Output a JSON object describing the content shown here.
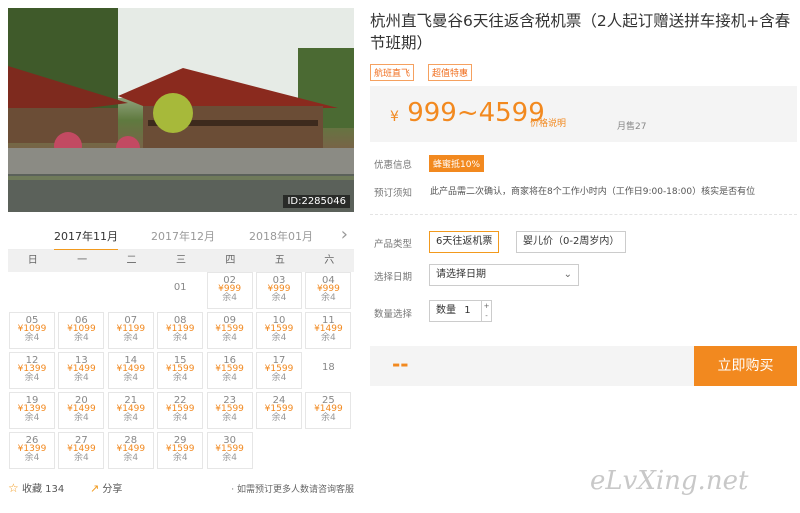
{
  "photo": {
    "id_label": "ID:2285046"
  },
  "calendar": {
    "months": [
      "2017年11月",
      "2017年12月",
      "2018年01月"
    ],
    "weekdays": [
      "日",
      "一",
      "二",
      "三",
      "四",
      "五",
      "六"
    ],
    "days": [
      {
        "d": "01"
      },
      {
        "d": "02",
        "p": "¥999",
        "r": "余4"
      },
      {
        "d": "03",
        "p": "¥999",
        "r": "余4"
      },
      {
        "d": "04",
        "p": "¥999",
        "r": "余4"
      },
      {
        "d": "05",
        "p": "¥1099",
        "r": "余4"
      },
      {
        "d": "06",
        "p": "¥1099",
        "r": "余4"
      },
      {
        "d": "07",
        "p": "¥1199",
        "r": "余4"
      },
      {
        "d": "08",
        "p": "¥1199",
        "r": "余4"
      },
      {
        "d": "09",
        "p": "¥1599",
        "r": "余4"
      },
      {
        "d": "10",
        "p": "¥1599",
        "r": "余4"
      },
      {
        "d": "11",
        "p": "¥1499",
        "r": "余4"
      },
      {
        "d": "12",
        "p": "¥1399",
        "r": "余4"
      },
      {
        "d": "13",
        "p": "¥1499",
        "r": "余4"
      },
      {
        "d": "14",
        "p": "¥1499",
        "r": "余4"
      },
      {
        "d": "15",
        "p": "¥1599",
        "r": "余4"
      },
      {
        "d": "16",
        "p": "¥1599",
        "r": "余4"
      },
      {
        "d": "17",
        "p": "¥1599",
        "r": "余4"
      },
      {
        "d": "18"
      },
      {
        "d": "19",
        "p": "¥1399",
        "r": "余4"
      },
      {
        "d": "20",
        "p": "¥1499",
        "r": "余4"
      },
      {
        "d": "21",
        "p": "¥1499",
        "r": "余4"
      },
      {
        "d": "22",
        "p": "¥1599",
        "r": "余4"
      },
      {
        "d": "23",
        "p": "¥1599",
        "r": "余4"
      },
      {
        "d": "24",
        "p": "¥1599",
        "r": "余4"
      },
      {
        "d": "25",
        "p": "¥1499",
        "r": "余4"
      },
      {
        "d": "26",
        "p": "¥1399",
        "r": "余4"
      },
      {
        "d": "27",
        "p": "¥1499",
        "r": "余4"
      },
      {
        "d": "28",
        "p": "¥1499",
        "r": "余4"
      },
      {
        "d": "29",
        "p": "¥1599",
        "r": "余4"
      },
      {
        "d": "30",
        "p": "¥1599",
        "r": "余4"
      }
    ]
  },
  "share": {
    "fav_label": "收藏",
    "fav_count": "134",
    "share_label": "分享",
    "note": "· 如需预订更多人数请咨询客服"
  },
  "product": {
    "title": "杭州直飞曼谷6天往返含税机票（2人起订赠送拼车接机+含春节班期）",
    "tags": [
      "航班直飞",
      "超值特惠"
    ],
    "price_symbol": "¥",
    "price": "999~4599",
    "price_note": "价格说明",
    "sold": "月售27"
  },
  "info": {
    "promo_label": "优惠信息",
    "promo_badge": "蜂蜜抵10%",
    "notice_label": "预订须知",
    "notice_text": "此产品需二次确认，商家将在8个工作小时内（工作日9:00-18:00）核实是否有位"
  },
  "booking": {
    "type_label": "产品类型",
    "options": [
      "6天往返机票",
      "婴儿价（0-2周岁内）"
    ],
    "date_label": "选择日期",
    "date_placeholder": "请选择日期",
    "qty_label": "数量选择",
    "qty_prefix": "数量",
    "qty_value": "1",
    "total": "--",
    "buy_label": "立即购买"
  },
  "watermark": "eLvXing.net",
  "colors": {
    "accent": "#f2891f"
  }
}
